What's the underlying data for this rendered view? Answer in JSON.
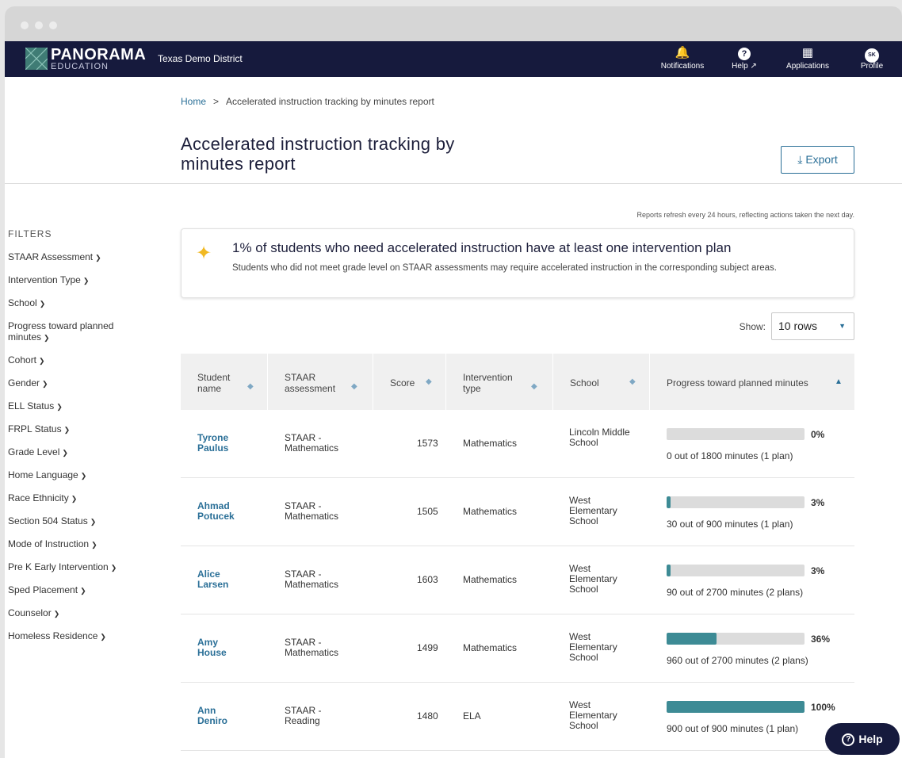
{
  "nav": {
    "brand": "PANORAMA",
    "brand_sub": "EDUCATION",
    "district": "Texas Demo District",
    "items": [
      {
        "label": "Notifications",
        "icon": "bell-icon"
      },
      {
        "label": "Help ↗",
        "icon": "help-icon"
      },
      {
        "label": "Applications",
        "icon": "grid-icon"
      },
      {
        "label": "Profile",
        "icon": "avatar",
        "initials": "SK"
      }
    ]
  },
  "breadcrumb": {
    "home": "Home",
    "separator": ">",
    "current": "Accelerated instruction tracking by minutes report"
  },
  "page": {
    "title": "Accelerated instruction tracking by minutes report",
    "export_label": "Export",
    "refresh_note": "Reports refresh every 24 hours, reflecting actions taken the next day."
  },
  "filters": {
    "heading": "FILTERS",
    "items": [
      "STAAR Assessment",
      "Intervention Type",
      "School",
      "Progress toward planned minutes",
      "Cohort",
      "Gender",
      "ELL Status",
      "FRPL Status",
      "Grade Level",
      "Home Language",
      "Race Ethnicity",
      "Section 504 Status",
      "Mode of Instruction",
      "Pre K Early Intervention",
      "Sped Placement",
      "Counselor",
      "Homeless Residence"
    ]
  },
  "callout": {
    "headline": "1% of students who need accelerated instruction have at least one intervention plan",
    "body": "Students who did not meet grade level on STAAR assessments may require accelerated instruction in the corresponding subject areas."
  },
  "show": {
    "label": "Show:",
    "value": "10 rows"
  },
  "table": {
    "columns": [
      "Student name",
      "STAAR assessment",
      "Score",
      "Intervention type",
      "School",
      "Progress toward planned minutes"
    ],
    "rows": [
      {
        "name": "Tyrone Paulus",
        "assessment": "STAAR - Mathematics",
        "score": "1573",
        "type": "Mathematics",
        "school": "Lincoln Middle School",
        "progress": 0,
        "pct": "0%",
        "minutes": "0 out of 1800 minutes (1 plan)"
      },
      {
        "name": "Ahmad Potucek",
        "assessment": "STAAR - Mathematics",
        "score": "1505",
        "type": "Mathematics",
        "school": "West Elementary School",
        "progress": 3,
        "pct": "3%",
        "minutes": "30 out of 900 minutes (1 plan)"
      },
      {
        "name": "Alice Larsen",
        "assessment": "STAAR - Mathematics",
        "score": "1603",
        "type": "Mathematics",
        "school": "West Elementary School",
        "progress": 3,
        "pct": "3%",
        "minutes": "90 out of 2700 minutes (2 plans)"
      },
      {
        "name": "Amy House",
        "assessment": "STAAR - Mathematics",
        "score": "1499",
        "type": "Mathematics",
        "school": "West Elementary School",
        "progress": 36,
        "pct": "36%",
        "minutes": "960 out of 2700 minutes (2 plans)"
      },
      {
        "name": "Ann Deniro",
        "assessment": "STAAR - Reading",
        "score": "1480",
        "type": "ELA",
        "school": "West Elementary School",
        "progress": 100,
        "pct": "100%",
        "minutes": "900 out of 900 minutes (1 plan)"
      }
    ]
  },
  "help_fab": {
    "label": "Help"
  },
  "colors": {
    "navy": "#161a3d",
    "link": "#2a6f97",
    "bar": "#3d8b95",
    "sparkle": "#f1b922"
  }
}
